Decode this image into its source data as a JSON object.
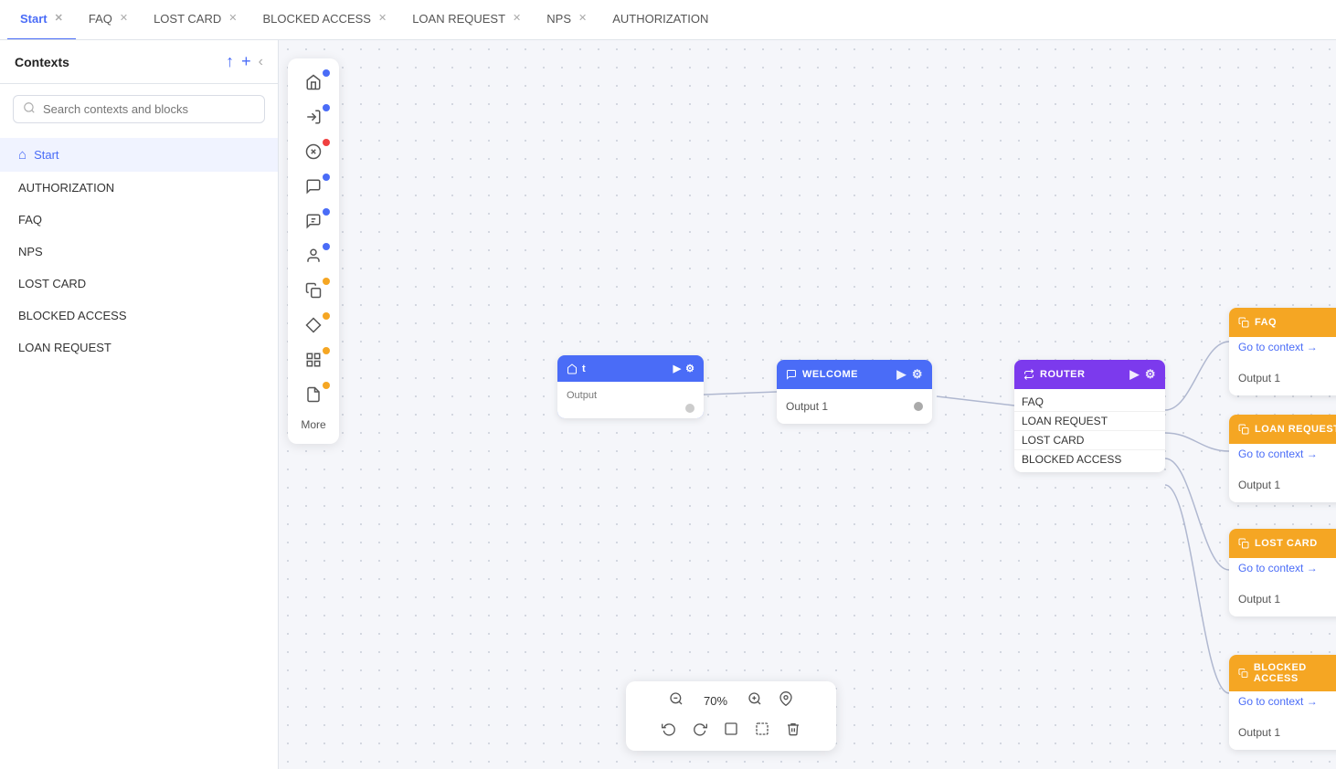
{
  "sidebar": {
    "title": "Contexts",
    "search_placeholder": "Search contexts and blocks",
    "items": [
      {
        "id": "start",
        "label": "Start",
        "active": true,
        "has_home": true
      },
      {
        "id": "authorization",
        "label": "AUTHORIZATION",
        "active": false
      },
      {
        "id": "faq",
        "label": "FAQ",
        "active": false
      },
      {
        "id": "nps",
        "label": "NPS",
        "active": false
      },
      {
        "id": "lost-card",
        "label": "LOST CARD",
        "active": false
      },
      {
        "id": "blocked-access",
        "label": "BLOCKED ACCESS",
        "active": false
      },
      {
        "id": "loan-request",
        "label": "LOAN REQUEST",
        "active": false
      }
    ]
  },
  "tabs": [
    {
      "id": "start",
      "label": "Start",
      "active": true,
      "closable": true
    },
    {
      "id": "faq",
      "label": "FAQ",
      "active": false,
      "closable": true
    },
    {
      "id": "lost-card",
      "label": "LOST CARD",
      "active": false,
      "closable": true
    },
    {
      "id": "blocked-access",
      "label": "BLOCKED ACCESS",
      "active": false,
      "closable": true
    },
    {
      "id": "loan-request",
      "label": "LOAN REQUEST",
      "active": false,
      "closable": true
    },
    {
      "id": "nps",
      "label": "NPS",
      "active": false,
      "closable": true
    },
    {
      "id": "authorization",
      "label": "AUTHORIZATION",
      "active": false,
      "closable": false
    }
  ],
  "tools": [
    {
      "id": "home",
      "icon": "⌂",
      "dot_color": "blue"
    },
    {
      "id": "enter",
      "icon": "↩",
      "dot_color": "blue"
    },
    {
      "id": "close-circle",
      "icon": "⊗",
      "dot_color": "red"
    },
    {
      "id": "message",
      "icon": "☐",
      "dot_color": "blue"
    },
    {
      "id": "chat",
      "icon": "⊟",
      "dot_color": "blue"
    },
    {
      "id": "person",
      "icon": "⊡",
      "dot_color": "blue"
    },
    {
      "id": "copy",
      "icon": "⧉",
      "dot_color": "orange"
    },
    {
      "id": "diamond",
      "icon": "◈",
      "dot_color": "orange"
    },
    {
      "id": "grid",
      "icon": "⊞",
      "dot_color": "orange"
    },
    {
      "id": "document",
      "icon": "⊟",
      "dot_color": "orange"
    }
  ],
  "more_label": "More",
  "nodes": {
    "start": {
      "label": "t",
      "type": "start"
    },
    "welcome": {
      "label": "WELCOME",
      "type": "message",
      "output": "Output 1"
    },
    "router": {
      "label": "ROUTER",
      "type": "router",
      "items": [
        "FAQ",
        "LOAN REQUEST",
        "LOST CARD",
        "BLOCKED ACCESS"
      ]
    },
    "faq_context": {
      "label": "FAQ",
      "type": "context",
      "link": "Go to context →",
      "output": "Output 1"
    },
    "loan_request_context": {
      "label": "LOAN REQUEST",
      "type": "context",
      "link": "Go to context →",
      "output": "Output 1"
    },
    "lost_card_context": {
      "label": "LOST CARD",
      "type": "context",
      "link": "Go to context →",
      "output": "Output 1"
    },
    "blocked_access_context": {
      "label": "BLOCKED ACCESS",
      "type": "context",
      "link": "Go to context →",
      "output": "Output 1"
    }
  },
  "zoom": {
    "level": "70%",
    "zoom_in_label": "+",
    "zoom_out_label": "−"
  },
  "colors": {
    "blue": "#4a6cf7",
    "orange": "#f5a623",
    "purple": "#7c3aed",
    "red": "#f04040"
  }
}
